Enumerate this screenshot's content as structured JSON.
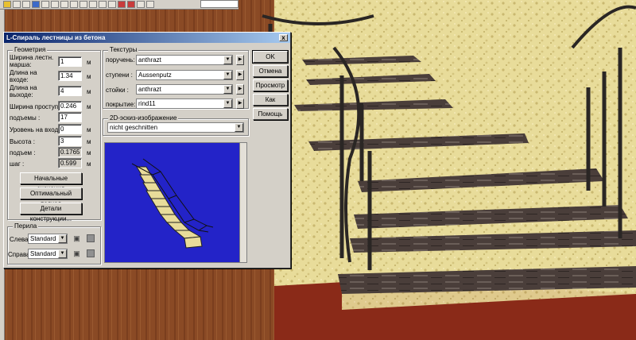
{
  "dialog": {
    "title": "L-Спираль лестницы из бетона",
    "close_glyph": "x"
  },
  "geometry": {
    "title": "Геометрия",
    "fields": [
      {
        "label": "Ширина лестн. марша:",
        "value": "1",
        "unit": "м"
      },
      {
        "label": "Длина на входе:",
        "value": "1.34",
        "unit": "м"
      },
      {
        "label": "Длина на выходе:",
        "value": "4",
        "unit": "м"
      },
      {
        "label": "Ширина проступи:",
        "value": "0.246",
        "unit": "м"
      },
      {
        "label": "подъемы :",
        "value": "17",
        "unit": ""
      },
      {
        "label": "Уровень на входе:",
        "value": "0",
        "unit": "м"
      },
      {
        "label": "Высота :",
        "value": "3",
        "unit": "м"
      },
      {
        "label": "подъем :",
        "value": "0.1765",
        "unit": "м"
      },
      {
        "label": "шаг :",
        "value": "0.599",
        "unit": "м"
      }
    ],
    "buttons": [
      "Начальные значения",
      "Оптимальный подход",
      "Детали конструкции..."
    ]
  },
  "railing": {
    "title": "Перила",
    "left_label": "Слева:",
    "left_value": "Standard",
    "right_label": "Справа:",
    "right_value": "Standard"
  },
  "textures": {
    "title": "Текстуры",
    "rows": [
      {
        "label": "поручень:",
        "value": "anthrazt"
      },
      {
        "label": "ступени :",
        "value": "Aussenputz"
      },
      {
        "label": "стойки :",
        "value": "anthrazt"
      },
      {
        "label": "покрытие:",
        "value": "rind11"
      }
    ]
  },
  "preview": {
    "title": "2D-эскиз-изображение",
    "value": "nicht geschnitten"
  },
  "side_buttons": [
    "OK",
    "Отмена",
    "Просмотр",
    "Как стандарт",
    "Помощь"
  ],
  "colors": {
    "title_bar": "#0a246a",
    "dialog_bg": "#d4d0c8",
    "preview_bg": "#2323c8"
  }
}
